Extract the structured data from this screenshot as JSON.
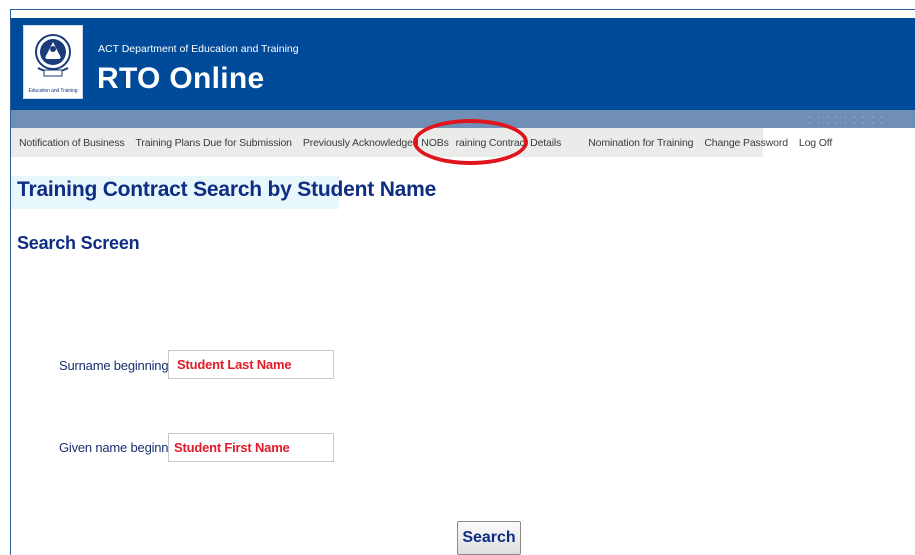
{
  "header": {
    "logo_caption": "Education and Training",
    "department": "ACT Department of Education and Training",
    "app_title": "RTO Online"
  },
  "nav": {
    "items": [
      {
        "label": "Notification of Business"
      },
      {
        "label": "Training Plans Due for Submission"
      },
      {
        "label": "Previously Acknowledged NOBs"
      },
      {
        "label": "raining Contract Details"
      },
      {
        "label": "Nomination for Training"
      },
      {
        "label": "Change Password"
      },
      {
        "label": "Log Off"
      }
    ],
    "highlight_color": "#e0141c"
  },
  "main": {
    "page_title": "Training Contract Search by Student Name",
    "section_title": "Search Screen",
    "surname": {
      "label": "Surname beginning:",
      "value": "Student Last Name"
    },
    "given_name": {
      "label": "Given name beginning:",
      "value": "Student First Name"
    },
    "search_button": "Search"
  },
  "colors": {
    "header_bg": "#004a9a",
    "subbar_bg": "#6f8fb6",
    "heading_text": "#0e2d83",
    "field_text": "#e01b2a"
  }
}
